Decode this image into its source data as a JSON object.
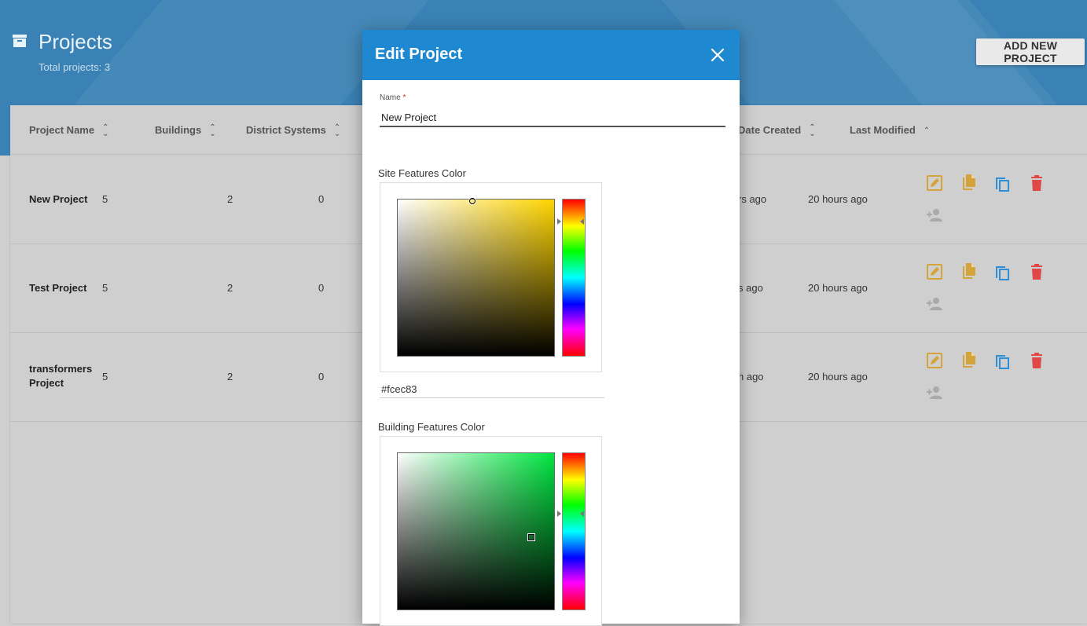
{
  "header": {
    "title": "Projects",
    "subtitle": "Total projects: 3",
    "add_button_label": "ADD NEW PROJECT",
    "banner_color": "#3a82b5"
  },
  "table": {
    "columns": [
      {
        "label": "Project Name"
      },
      {
        "label": "Buildings"
      },
      {
        "label": "District Systems"
      },
      {
        "label": "Date Created"
      },
      {
        "label": "Last Modified"
      }
    ],
    "rows": [
      {
        "name": "New Project",
        "buildings_prefix": "5",
        "buildings": "2",
        "district_systems": "0",
        "date_created": "rs ago",
        "last_modified": "20 hours ago"
      },
      {
        "name": "Test Project",
        "buildings_prefix": "5",
        "buildings": "2",
        "district_systems": "0",
        "date_created": "s ago",
        "last_modified": "20 hours ago"
      },
      {
        "name": "transformers Project",
        "buildings_prefix": "5",
        "buildings": "2",
        "district_systems": "0",
        "date_created": "h ago",
        "last_modified": "20 hours ago"
      }
    ],
    "action_icons": [
      "edit-icon",
      "document-icon",
      "copy-icon",
      "delete-icon",
      "add-user-icon"
    ],
    "colors": {
      "edit": "#d4a33a",
      "doc": "#d4a33a",
      "copy": "#2f8fd6",
      "delete": "#e04848",
      "user": "#aaaaaa"
    }
  },
  "modal": {
    "title": "Edit Project",
    "header_color": "#1e88d0",
    "name_label": "Name",
    "name_required_mark": "*",
    "name_value": "New Project",
    "site_color_label": "Site Features Color",
    "site_color_hex": "#fcec83",
    "site_hue_color": "#ffd500",
    "building_color_label": "Building Features Color",
    "building_hue_color": "#00e640"
  }
}
